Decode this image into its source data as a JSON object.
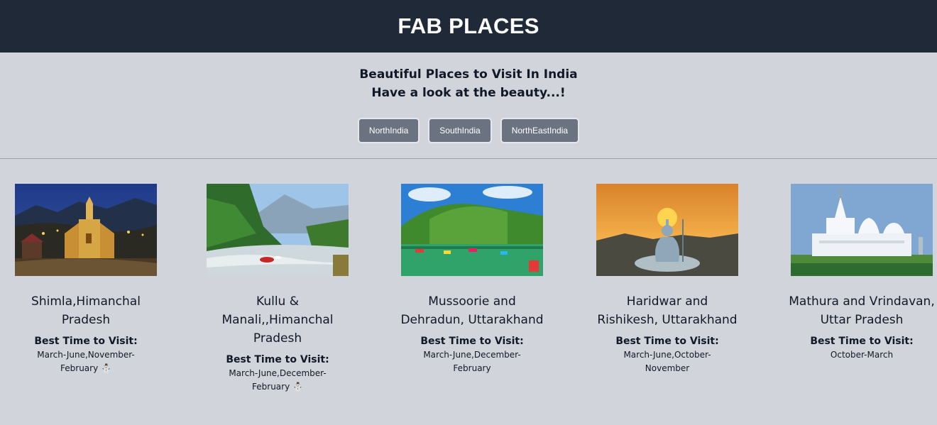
{
  "header": {
    "title": "FAB PLACES"
  },
  "intro": {
    "line1": "Beautiful Places to Visit In India",
    "line2": "Have a look at the beauty...!"
  },
  "buttons": [
    "NorthIndia",
    "SouthIndia",
    "NorthEastIndia"
  ],
  "best_label": "Best Time to Visit:",
  "places": [
    {
      "name_lines": [
        "Shimla,Himanchal",
        "Pradesh"
      ],
      "months_lines": [
        "March-June,November-",
        "February"
      ],
      "emoji": "⛄",
      "image": "church-night-photo"
    },
    {
      "name_lines": [
        "Kullu &",
        "Manali,,Himanchal",
        "Pradesh"
      ],
      "months_lines": [
        "March-June,December-",
        "February"
      ],
      "emoji": "⛄",
      "image": "river-valley-photo"
    },
    {
      "name_lines": [
        "Mussoorie and",
        "Dehradun, Uttarakhand"
      ],
      "months_lines": [
        "March-June,December-",
        "February"
      ],
      "emoji": "",
      "image": "lake-boats-photo"
    },
    {
      "name_lines": [
        "Haridwar and",
        "Rishikesh, Uttarakhand"
      ],
      "months_lines": [
        "March-June,October-",
        "November"
      ],
      "emoji": "",
      "image": "shiva-statue-sunset-photo"
    },
    {
      "name_lines": [
        "Mathura and Vrindavan,",
        "Uttar Pradesh"
      ],
      "months_lines": [
        "October-March"
      ],
      "emoji": "",
      "image": "white-temple-photo"
    }
  ]
}
